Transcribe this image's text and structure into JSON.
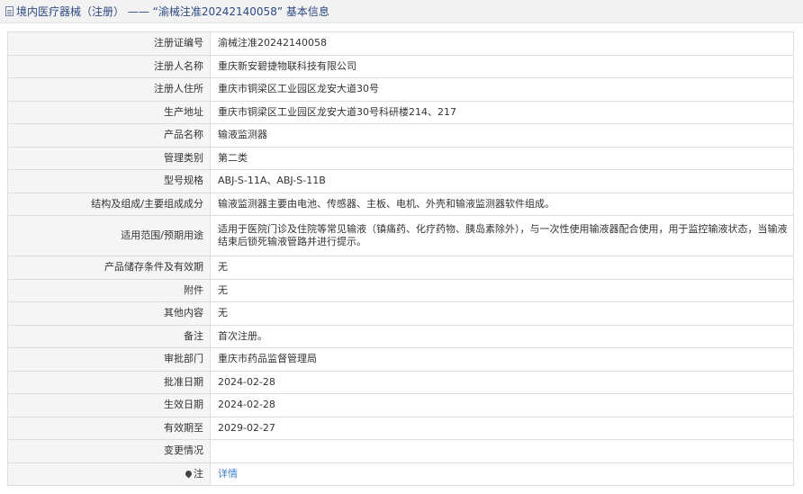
{
  "header": {
    "title": "境内医疗器械（注册） —— “渝械注准20242140058” 基本信息"
  },
  "rows": [
    {
      "label": "注册证编号",
      "value": "渝械注准20242140058"
    },
    {
      "label": "注册人名称",
      "value": "重庆新安碧捷物联科技有限公司"
    },
    {
      "label": "注册人住所",
      "value": "重庆市铜梁区工业园区龙安大道30号"
    },
    {
      "label": "生产地址",
      "value": "重庆市铜梁区工业园区龙安大道30号科研楼214、217"
    },
    {
      "label": "产品名称",
      "value": "输液监测器"
    },
    {
      "label": "管理类别",
      "value": "第二类"
    },
    {
      "label": "型号规格",
      "value": "ABJ-S-11A、ABJ-S-11B"
    },
    {
      "label": "结构及组成/主要组成成分",
      "value": "输液监测器主要由电池、传感器、主板、电机、外壳和输液监测器软件组成。"
    },
    {
      "label": "适用范围/预期用途",
      "value": "适用于医院门诊及住院等常见输液（镇痛药、化疗药物、胰岛素除外），与一次性使用输液器配合使用，用于监控输液状态，当输液结束后锁死输液管路并进行提示。"
    },
    {
      "label": "产品储存条件及有效期",
      "value": "无"
    },
    {
      "label": "附件",
      "value": "无"
    },
    {
      "label": "其他内容",
      "value": "无"
    },
    {
      "label": "备注",
      "value": "首次注册。"
    },
    {
      "label": "审批部门",
      "value": "重庆市药品监督管理局"
    },
    {
      "label": "批准日期",
      "value": "2024-02-28"
    },
    {
      "label": "生效日期",
      "value": "2024-02-28"
    },
    {
      "label": "有效期至",
      "value": "2029-02-27"
    },
    {
      "label": "变更情况",
      "value": ""
    }
  ],
  "note": {
    "label": "注",
    "link_text": "详情",
    "icon": "pin-icon"
  }
}
